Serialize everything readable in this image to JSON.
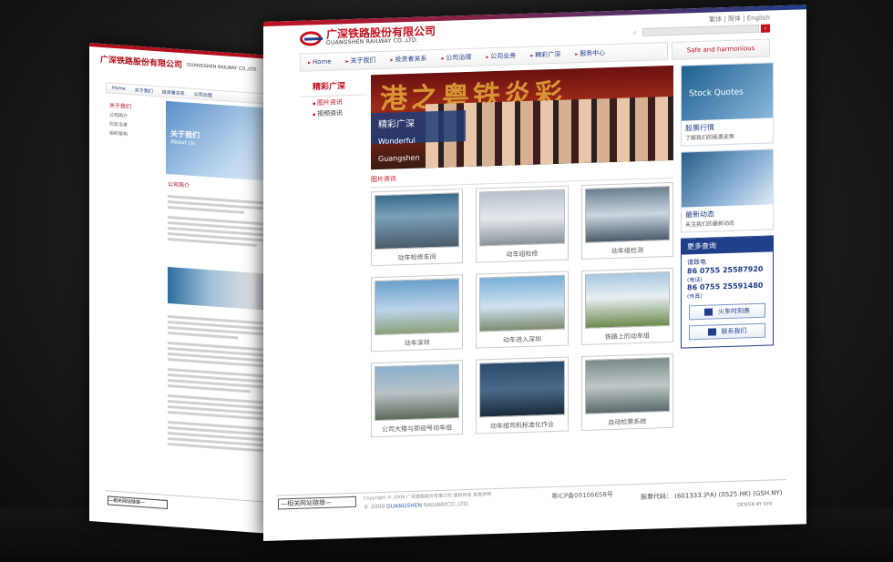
{
  "back": {
    "logo_cn": "广深铁路股份有限公司",
    "logo_en": "GUANGSHEN RAILWAY CO.,LTD.",
    "nav": [
      "Home",
      "关于我们",
      "投资者关系",
      "公司治理"
    ],
    "side_title": "关于我们",
    "side_links": [
      "公司简介",
      "历史沿革",
      "组织架构"
    ],
    "banner_cn": "关于我们",
    "banner_en": "About Us",
    "section": "公司简介",
    "select": "—相关网站链接—"
  },
  "front": {
    "logo_cn": "广深铁路股份有限公司",
    "logo_en": "GUANGSHEN RAILWAY CO.,LTD.",
    "langs": "繁体 | 简体 | English",
    "search_button": "›",
    "nav": [
      "Home",
      "关于我们",
      "投资者关系",
      "公司治理",
      "公司业务",
      "精彩广深",
      "服务中心"
    ],
    "tagline": "Safe and harmonious",
    "side_title": "精彩广深",
    "side_links": [
      "图片资讯",
      "视频资讯"
    ],
    "banner_cn": "精彩广深",
    "banner_en": "Wonderful Guangshen",
    "banner_big": "港之粤铁炎彩",
    "section_title": "图片资讯",
    "photos": [
      "动车检修车间",
      "动车组检修",
      "动车组检测",
      "动车深圳",
      "动车进入深圳",
      "铁路上的动车组",
      "公司大楼与即迎号动车组",
      "动车组司机标准化作业",
      "自动检票系统"
    ],
    "stock": {
      "img_label": "Stock Quotes",
      "title": "股票行情",
      "sub": "了解我们的股票走势"
    },
    "news": {
      "title": "最新动态",
      "sub": "关注我们的最新动态"
    },
    "more": {
      "title": "更多查询",
      "hotline_label": "请致电",
      "phone1": "86 0755 25587920",
      "phone1_note": "(电话)",
      "phone2": "86 0755 25591480",
      "phone2_note": "(传真)",
      "btn1": "火车时刻表",
      "btn2": "联系我们"
    },
    "footer": {
      "select": "—相关网站链接—",
      "copyright1": "Copyright © 2009  广深铁路股份有限公司  版权所有  免责声明",
      "copyright2_pre": "© 2009",
      "copyright2_link": "GUANGSHEN",
      "copyright2_post": "RAILWAYCO.,LTD.",
      "icp": "粤ICP备09106658号",
      "codes": "股票代码： (601333.沪A)  (0525.HK)  (GSH.NY)",
      "design": "DESIGN BY GYA"
    }
  },
  "colors": {
    "brand_red": "#c4121f",
    "brand_blue": "#1f3f8a"
  }
}
